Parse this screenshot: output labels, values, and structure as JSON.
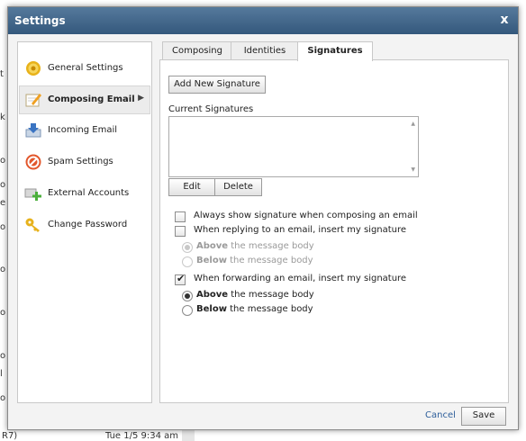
{
  "background": {
    "fragments": [
      "t",
      "k",
      "o",
      "o",
      "e",
      "o",
      "o",
      "o",
      "o",
      "o",
      "l",
      "o",
      "o"
    ],
    "bottom_left": "R7)",
    "bottom_date": "Tue 1/5 9:34 am"
  },
  "dialog": {
    "title": "Settings",
    "close_label": "x"
  },
  "nav": {
    "items": [
      {
        "label": "General Settings",
        "icon": "gear-icon",
        "active": false
      },
      {
        "label": "Composing Email",
        "icon": "compose-icon",
        "active": true
      },
      {
        "label": "Incoming Email",
        "icon": "inbox-download-icon",
        "active": false
      },
      {
        "label": "Spam Settings",
        "icon": "no-entry-icon",
        "active": false
      },
      {
        "label": "External Accounts",
        "icon": "add-account-icon",
        "active": false
      },
      {
        "label": "Change Password",
        "icon": "key-icon",
        "active": false
      }
    ],
    "active_chevron": "▶"
  },
  "tabs": [
    {
      "label": "Composing",
      "active": false
    },
    {
      "label": "Identities",
      "active": false
    },
    {
      "label": "Signatures",
      "active": true
    }
  ],
  "signatures": {
    "add_button": "Add New Signature",
    "current_label": "Current Signatures",
    "edit_button": "Edit",
    "delete_button": "Delete",
    "always_show": {
      "label": "Always show signature when composing an email",
      "checked": false
    },
    "reply": {
      "label": "When replying to an email, insert my signature",
      "checked": false
    },
    "reply_above": {
      "bold": "Above",
      "rest": " the message body",
      "selected": true,
      "disabled": true
    },
    "reply_below": {
      "bold": "Below",
      "rest": " the message body",
      "selected": false,
      "disabled": true
    },
    "forward": {
      "label": "When forwarding an email, insert my signature",
      "checked": true
    },
    "forward_above": {
      "bold": "Above",
      "rest": " the message body",
      "selected": true,
      "disabled": false
    },
    "forward_below": {
      "bold": "Below",
      "rest": " the message body",
      "selected": false,
      "disabled": false
    }
  },
  "footer": {
    "cancel": "Cancel",
    "save": "Save"
  },
  "colors": {
    "titlebar": "#34587c",
    "link": "#2d5e9a"
  }
}
